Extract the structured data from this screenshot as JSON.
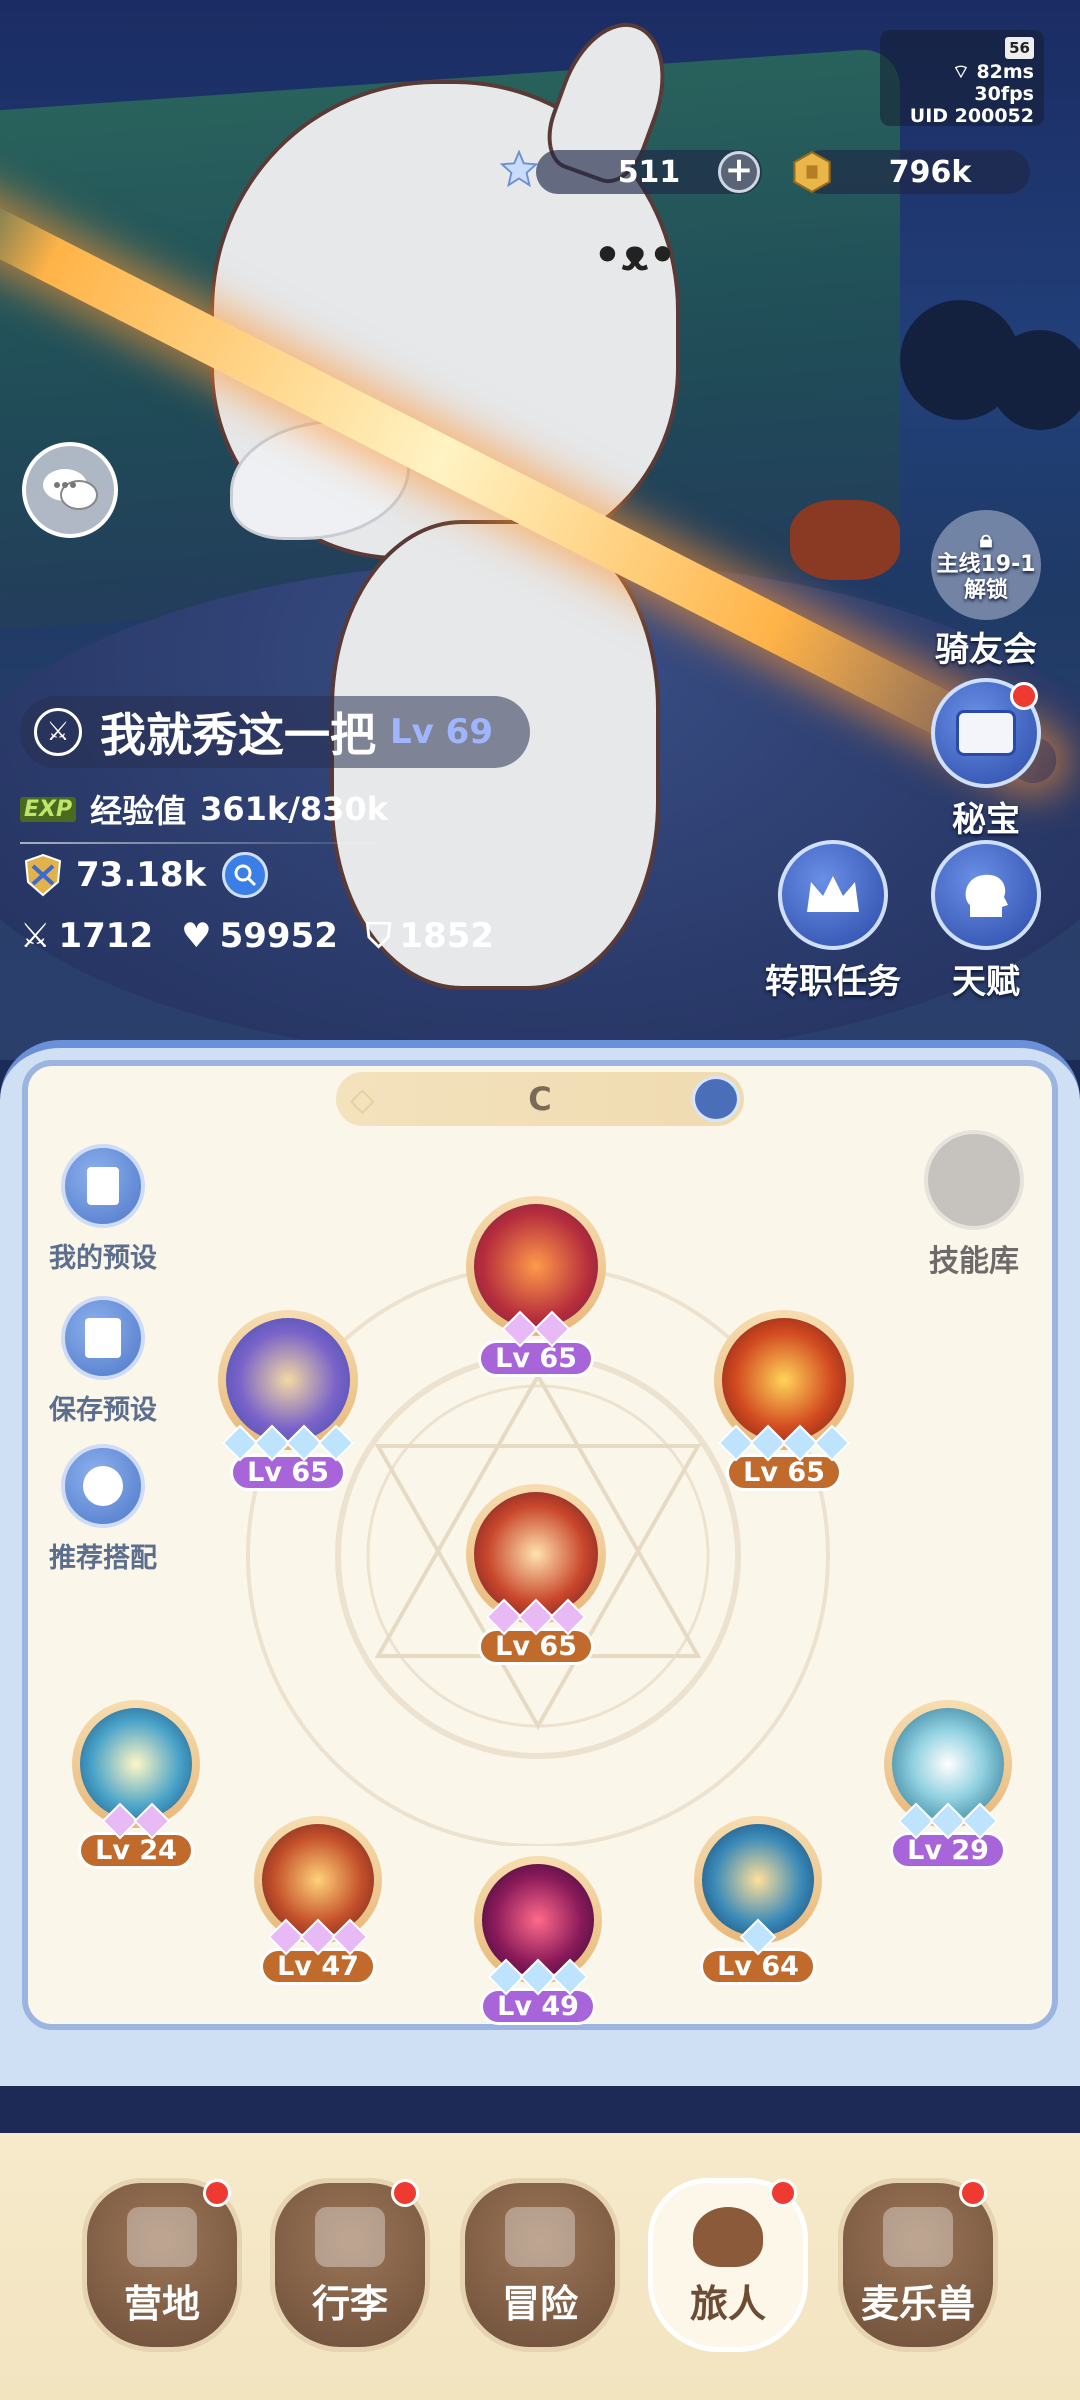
{
  "status": {
    "battery": "56",
    "ping": "82ms",
    "fps": "30fps",
    "uid": "UID 200052"
  },
  "currency": {
    "stars": "511",
    "coins": "796k"
  },
  "player": {
    "name": "我就秀这一把",
    "level": "Lv 69",
    "exp_tag": "EXP",
    "exp_label": "经验值",
    "exp_value": "361k/830k",
    "power": "73.18k",
    "attack": "1712",
    "hp": "59952",
    "defense": "1852"
  },
  "right_buttons": {
    "mount_lock_line1": "主线19-1",
    "mount_lock_line2": "解锁",
    "mount": "骑友会",
    "treasure": "秘宝",
    "job_quest": "转职任务",
    "talent": "天赋"
  },
  "panel": {
    "grade": "C",
    "my_presets": "我的预设",
    "save_preset": "保存预设",
    "recommend": "推荐搭配",
    "skill_library": "技能库",
    "skills": [
      {
        "level": "Lv 65"
      },
      {
        "level": "Lv 65"
      },
      {
        "level": "Lv 65"
      },
      {
        "level": "Lv 65"
      },
      {
        "level": "Lv 24"
      },
      {
        "level": "Lv 47"
      },
      {
        "level": "Lv 49"
      },
      {
        "level": "Lv 64"
      },
      {
        "level": "Lv 29"
      }
    ]
  },
  "nav": {
    "camp": "营地",
    "bag": "行李",
    "adventure": "冒险",
    "traveler": "旅人",
    "pets": "麦乐兽"
  },
  "colors": {
    "accent_blue": "#4a6fb8",
    "badge_red": "#ee3a30",
    "level_purple": "#a765d9",
    "level_brown": "#c06a2b"
  }
}
